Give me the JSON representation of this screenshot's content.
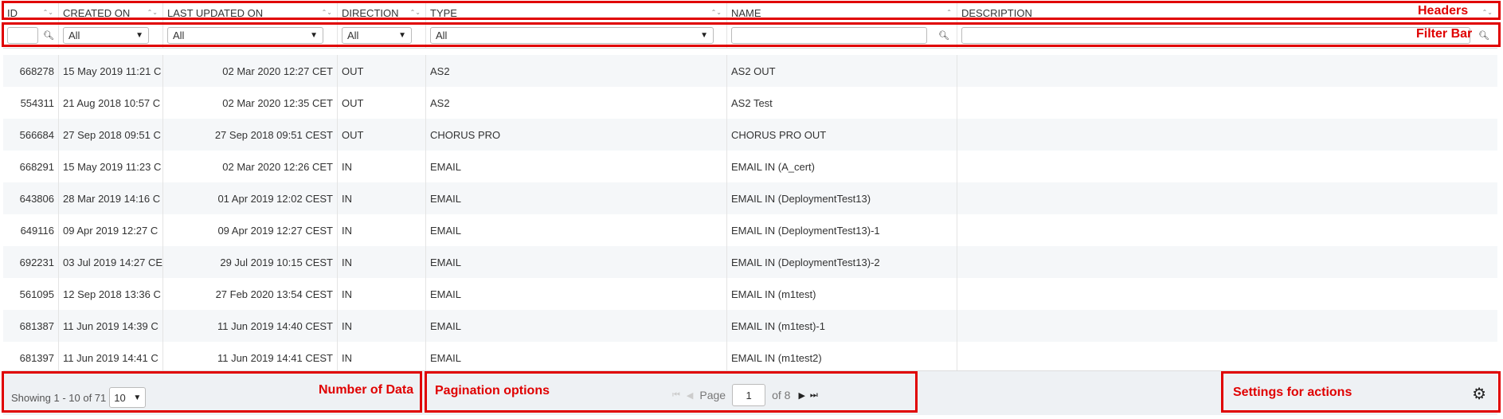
{
  "columns": [
    "ID",
    "CREATED ON",
    "LAST UPDATED ON",
    "DIRECTION",
    "TYPE",
    "NAME",
    "DESCRIPTION"
  ],
  "filters": {
    "created_on": "All",
    "last_updated_on": "All",
    "direction": "All",
    "type": "All"
  },
  "rows": [
    [
      "668278",
      "15 May 2019 11:21 C",
      "02 Mar 2020 12:27 CET",
      "OUT",
      "AS2",
      "AS2 OUT",
      ""
    ],
    [
      "554311",
      "21 Aug 2018 10:57 C",
      "02 Mar 2020 12:35 CET",
      "OUT",
      "AS2",
      "AS2 Test",
      ""
    ],
    [
      "566684",
      "27 Sep 2018 09:51 C",
      "27 Sep 2018 09:51 CEST",
      "OUT",
      "CHORUS PRO",
      "CHORUS PRO OUT",
      ""
    ],
    [
      "668291",
      "15 May 2019 11:23 C",
      "02 Mar 2020 12:26 CET",
      "IN",
      "EMAIL",
      "EMAIL IN (A_cert)",
      ""
    ],
    [
      "643806",
      "28 Mar 2019 14:16 C",
      "01 Apr 2019 12:02 CEST",
      "IN",
      "EMAIL",
      "EMAIL IN (DeploymentTest13)",
      ""
    ],
    [
      "649116",
      "09 Apr 2019 12:27 C",
      "09 Apr 2019 12:27 CEST",
      "IN",
      "EMAIL",
      "EMAIL IN (DeploymentTest13)-1",
      ""
    ],
    [
      "692231",
      "03 Jul 2019 14:27 CE",
      "29 Jul 2019 10:15 CEST",
      "IN",
      "EMAIL",
      "EMAIL IN (DeploymentTest13)-2",
      ""
    ],
    [
      "561095",
      "12 Sep 2018 13:36 C",
      "27 Feb 2020 13:54 CEST",
      "IN",
      "EMAIL",
      "EMAIL IN (m1test)",
      ""
    ],
    [
      "681387",
      "11 Jun 2019 14:39 C",
      "11 Jun 2019 14:40 CEST",
      "IN",
      "EMAIL",
      "EMAIL IN (m1test)-1",
      ""
    ],
    [
      "681397",
      "11 Jun 2019 14:41 C",
      "11 Jun 2019 14:41 CEST",
      "IN",
      "EMAIL",
      "EMAIL IN (m1test2)",
      ""
    ]
  ],
  "footer": {
    "showing": "Showing 1 - 10 of 71",
    "page_size": "10",
    "page_label": "Page",
    "page_value": "1",
    "of_pages": "of 8"
  },
  "annotations": {
    "headers": "Headers",
    "filter_bar": "Filter Bar",
    "number_of_data": "Number of Data",
    "pagination": "Pagination options",
    "settings": "Settings for actions"
  },
  "icons": {
    "sort": "sort-icon",
    "search": "search-icon",
    "dropdown": "chevron-down-icon",
    "first_page": "first-page-icon",
    "prev_page": "prev-page-icon",
    "next_page": "next-page-icon",
    "last_page": "last-page-icon",
    "settings": "gear-icon"
  },
  "colors": {
    "annotation": "#e00000",
    "stripe": "#f5f7f9",
    "footer_bg": "#eef1f4"
  }
}
